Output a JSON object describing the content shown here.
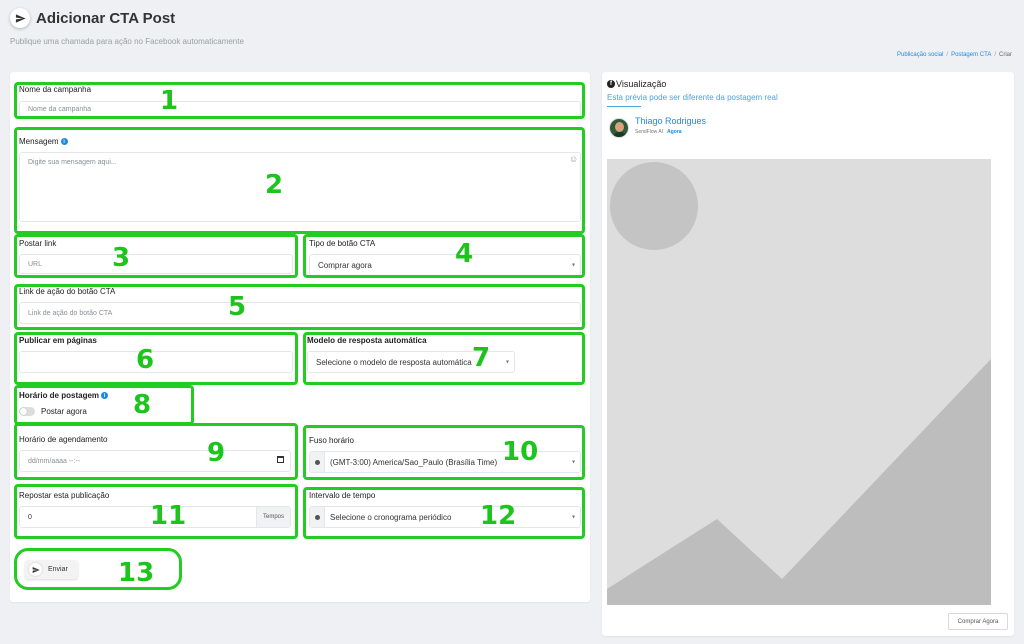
{
  "header": {
    "title": "Adicionar CTA Post",
    "subtitle": "Publique uma chamada para ação no Facebook automaticamente",
    "title_icon": "paper-plane-icon"
  },
  "breadcrumb": [
    "Publicação social",
    "Postagem CTA",
    "Criar"
  ],
  "form": {
    "campaign_name": {
      "label": "Nome da campanha",
      "placeholder": "Nome da campanha"
    },
    "message": {
      "label": "Mensagem",
      "placeholder": "Digite sua mensagem aqui..."
    },
    "post_link": {
      "label": "Postar link",
      "placeholder": "URL"
    },
    "cta_type": {
      "label": "Tipo de botão CTA",
      "value": "Comprar agora"
    },
    "cta_link": {
      "label": "Link de ação do botão CTA",
      "placeholder": "Link de ação do botão CTA"
    },
    "pages": {
      "label": "Publicar em páginas"
    },
    "auto_reply": {
      "label": "Modelo de resposta automática",
      "value": "Selecione o modelo de resposta automática"
    },
    "schedule_time": {
      "label": "Horário de postagem",
      "toggle_label": "Postar agora"
    },
    "schedule_date": {
      "label": "Horário de agendamento",
      "placeholder": "dd/mm/aaaa --:--"
    },
    "timezone": {
      "label": "Fuso horário",
      "value": "(GMT-3:00) America/Sao_Paulo (Brasília Time)"
    },
    "repost": {
      "label": "Repostar esta publicação",
      "value": "0",
      "addon": "Tempos"
    },
    "interval": {
      "label": "Intervalo de tempo",
      "value": "Selecione o cronograma periódico"
    },
    "submit_label": "Enviar"
  },
  "annotations": [
    "1",
    "2",
    "3",
    "4",
    "5",
    "6",
    "7",
    "8",
    "9",
    "10",
    "11",
    "12",
    "13"
  ],
  "preview": {
    "title": "Visualização",
    "note": "Esta prévia pode ser diferente da postagem real",
    "user_name": "Thiago Rodrigues",
    "app_name": "SendFlow AI",
    "time": "Agora",
    "cta_button": "Comprar Agora"
  },
  "colors": {
    "annotation": "#22cc22",
    "accent": "#1e88e5"
  }
}
